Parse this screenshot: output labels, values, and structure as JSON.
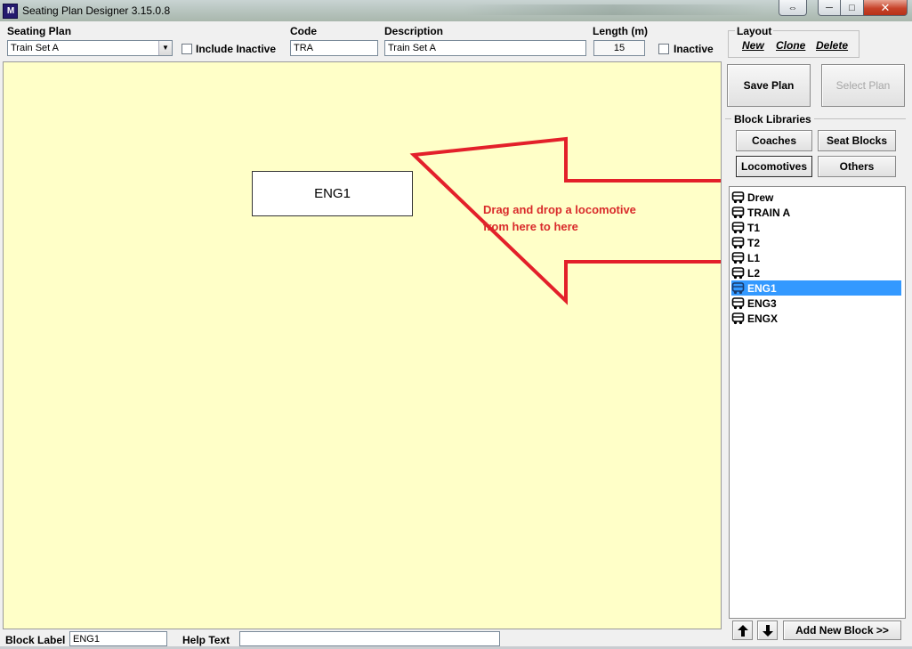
{
  "window": {
    "logo_text": "M",
    "title": "Seating Plan Designer  3.15.0.8",
    "close_glyph": "✕",
    "minimize_glyph": "─",
    "maximize_glyph": "□",
    "restore_glyph": "⇔"
  },
  "form": {
    "seating_plan_label": "Seating Plan",
    "seating_plan_value": "Train Set A",
    "include_inactive_label": "Include Inactive",
    "code_label": "Code",
    "code_value": "TRA",
    "description_label": "Description",
    "description_value": "Train Set A",
    "length_label": "Length (m)",
    "length_value": "15",
    "inactive_label": "Inactive"
  },
  "layout": {
    "legend": "Layout",
    "new_label": "New",
    "clone_label": "Clone",
    "delete_label": "Delete"
  },
  "actions": {
    "save_plan": "Save Plan",
    "select_plan": "Select Plan"
  },
  "block_libraries": {
    "legend": "Block Libraries",
    "coaches": "Coaches",
    "seat_blocks": "Seat Blocks",
    "locomotives": "Locomotives",
    "others": "Others"
  },
  "canvas": {
    "block_label": "ENG1",
    "hint_line1": "Drag and drop a locomotive",
    "hint_line2": "from here to here"
  },
  "block_list": {
    "items": [
      "Drew",
      "TRAIN A",
      "T1",
      "T2",
      "L1",
      "L2",
      "ENG1",
      "ENG3",
      "ENGX"
    ],
    "selected": "ENG1"
  },
  "bottom": {
    "add_new_block": "Add New Block >>",
    "block_label_label": "Block Label",
    "block_label_value": "ENG1",
    "help_text_label": "Help Text",
    "help_text_value": ""
  },
  "colors": {
    "canvas_bg": "#ffffc8",
    "hint_red": "#e3202a",
    "selection_blue": "#3399ff"
  }
}
